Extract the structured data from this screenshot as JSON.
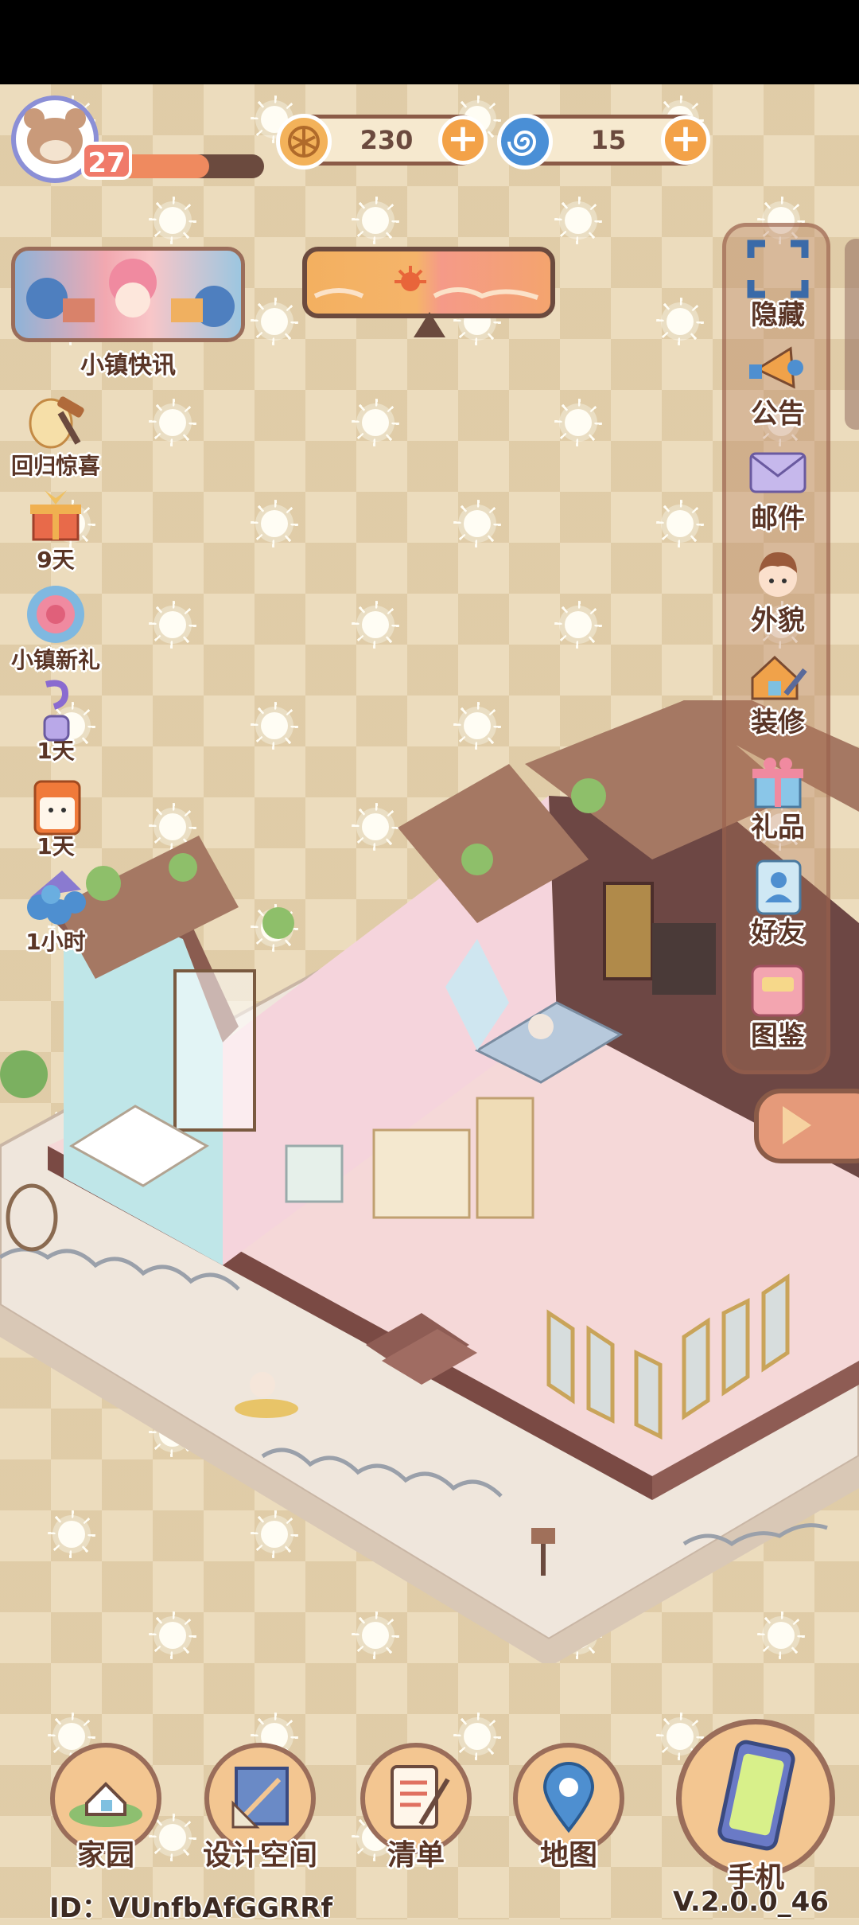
{
  "top_bar": {
    "player_level": "27",
    "xp_fraction": 0.62,
    "coins": "230",
    "gems": "15"
  },
  "news": {
    "label": "小镇快讯"
  },
  "left_column": [
    {
      "label": "回归惊喜",
      "icon": "hammer-egg-icon"
    },
    {
      "label": "9天",
      "icon": "gift-box-icon"
    },
    {
      "label": "小镇新礼",
      "icon": "rose-badge-icon"
    },
    {
      "label": "1天",
      "icon": "potion-bottle-icon"
    },
    {
      "label": "1天",
      "icon": "milk-carton-icon"
    },
    {
      "label": "1小时",
      "icon": "blue-flower-bag-icon"
    }
  ],
  "right_menu": [
    {
      "label": "隐藏",
      "icon": "hide-frame-icon"
    },
    {
      "label": "公告",
      "icon": "megaphone-icon"
    },
    {
      "label": "邮件",
      "icon": "envelope-icon"
    },
    {
      "label": "外貌",
      "icon": "character-head-icon"
    },
    {
      "label": "装修",
      "icon": "house-wrench-icon"
    },
    {
      "label": "礼品",
      "icon": "gift-icon"
    },
    {
      "label": "好友",
      "icon": "friend-book-icon"
    },
    {
      "label": "图鉴",
      "icon": "album-icon"
    }
  ],
  "bottom_nav": [
    {
      "label": "家园",
      "icon": "home-island-icon"
    },
    {
      "label": "设计空间",
      "icon": "blueprint-icon"
    },
    {
      "label": "清单",
      "icon": "checklist-icon"
    },
    {
      "label": "地图",
      "icon": "map-pin-icon"
    },
    {
      "label": "手机",
      "icon": "phone-icon"
    }
  ],
  "footer": {
    "player_id": "ID：VUnfbAfGGRRf",
    "version": "V.2.0.0_46"
  },
  "colors": {
    "panel_brown": "#8b5b47",
    "accent_orange": "#f3a248",
    "label_text": "#5a3526",
    "avatar_ring": "#8b8fd6"
  }
}
